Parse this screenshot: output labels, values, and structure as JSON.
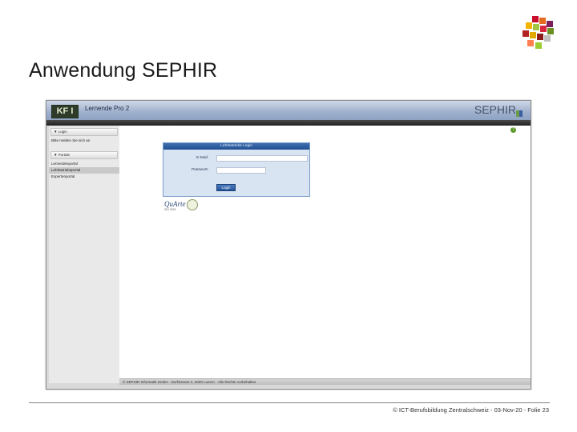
{
  "slide": {
    "title": "Anwendung SEPHIR",
    "footer": "© ICT-Berufsbildung Zentralschweiz - 03-Nov-20 - Folie 23"
  },
  "app": {
    "logo_text": "KF I",
    "name": "Lernende Pro 2",
    "brand": "SEPHIR",
    "help_symbol": "?",
    "sidebar": {
      "login_header": "▼ Login",
      "login_text": "Bitte melden Sie sich an",
      "portals_header": "▼ Portale",
      "items": [
        {
          "label": "Lernendenportal"
        },
        {
          "label": "Lehrbetriebsportal"
        },
        {
          "label": "Expertenportal"
        }
      ]
    },
    "login_form": {
      "title": "Lehrbetriebs Login",
      "email_label": "E-Mail:",
      "password_label": "Passwort:",
      "button_label": "Login"
    },
    "quality_mark": {
      "text": "QuArte",
      "sub": "ISO 9001"
    },
    "footer_text": "© SEPHIR Informatik GmbH · Dorfstrasse 2, 6000 Luzern · Alle Rechte vorbehalten"
  },
  "colors": {
    "header_blue": "#9eb0cc",
    "panel_blue": "#d8e4f2",
    "title_blue": "#1f4f91",
    "help_green": "#5d9a2c"
  }
}
